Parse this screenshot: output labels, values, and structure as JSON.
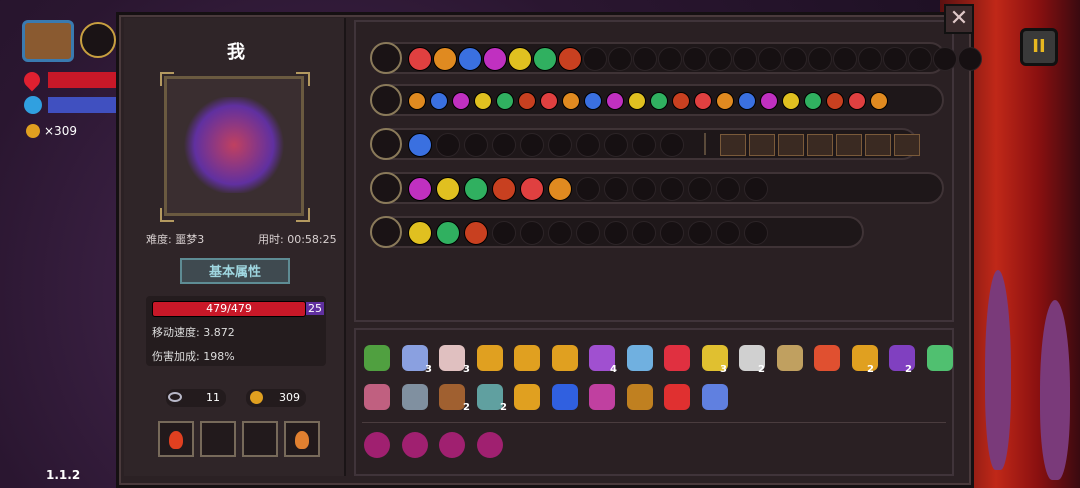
{
  "player": {
    "name": "我",
    "difficulty": "难度: 噩梦3",
    "time": "用时: 00:58:25"
  },
  "hud": {
    "gold": "×309"
  },
  "tabs": {
    "basic_attributes": "基本属性"
  },
  "stats": {
    "hp": "479/479",
    "shield": "25",
    "move_speed": "移动速度: 3.872",
    "damage_bonus": "伤害加成: 198%"
  },
  "currency": {
    "keys": "11",
    "gold": "309"
  },
  "version": "1.1.2",
  "buttons": {
    "close": "✕",
    "pause": "II"
  },
  "colors": {
    "hp": "#c81828",
    "accent": "#9fd6e0",
    "panel": "#2b2124"
  },
  "badges": {
    "b1": "3",
    "b2": "3",
    "b3": "4",
    "b4": "3",
    "b5": "2",
    "b6": "2",
    "b7": "2",
    "b8": "2",
    "b9": "2"
  }
}
